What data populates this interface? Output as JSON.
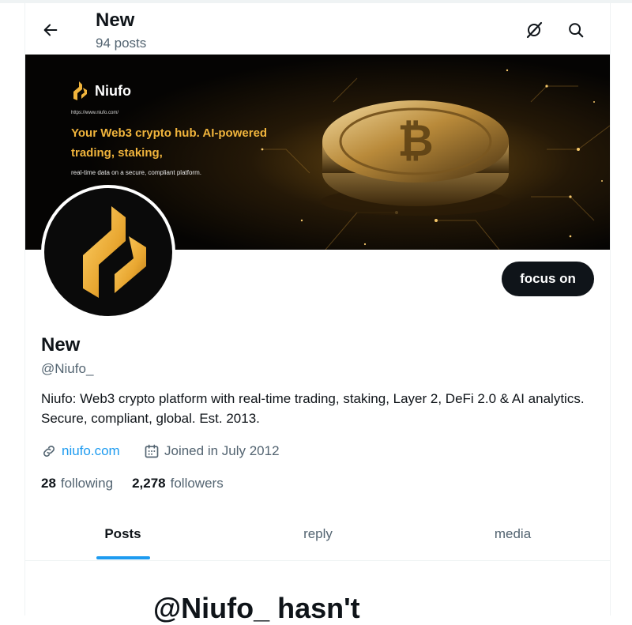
{
  "header": {
    "title": "New",
    "post_count": "94 posts"
  },
  "banner": {
    "brand": "Niufo",
    "url": "https://www.niufo.com/",
    "headline": "Your Web3 crypto hub. AI-powered trading, staking,",
    "subtext": "real-time data on a secure, compliant platform."
  },
  "profile": {
    "name": "New",
    "handle": "@Niufo_",
    "bio": "Niufo: Web3 crypto platform with real-time trading, staking, Layer 2, DeFi 2.0 & AI analytics. Secure, compliant, global. Est. 2013.",
    "website": "niufo.com",
    "joined": "Joined in July 2012",
    "follow_label": "focus on"
  },
  "stats": {
    "following_count": "28",
    "following_label": "following",
    "followers_count": "2,278",
    "followers_label": "followers"
  },
  "tabs": [
    {
      "label": "Posts",
      "active": true
    },
    {
      "label": "reply",
      "active": false
    },
    {
      "label": "media",
      "active": false
    }
  ],
  "empty_state": {
    "title": "@Niufo_ hasn't"
  },
  "icons": {
    "back": "arrow-left-icon",
    "grok": "grok-icon",
    "search": "search-icon",
    "link": "link-icon",
    "calendar": "calendar-icon"
  },
  "colors": {
    "accent": "#1d9bf0",
    "text": "#0f1419",
    "muted": "#536471",
    "gold": "#f0b43c"
  }
}
